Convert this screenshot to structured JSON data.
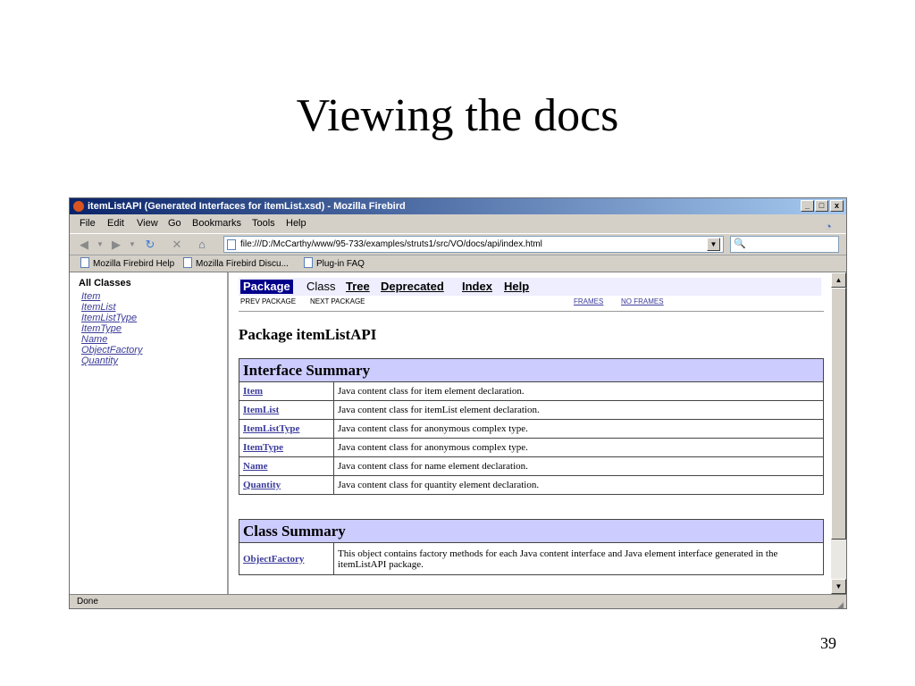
{
  "slide": {
    "title": "Viewing the docs",
    "page_number": "39"
  },
  "window": {
    "title": "itemListAPI (Generated Interfaces for itemList.xsd) - Mozilla Firebird",
    "controls": {
      "minimize": "_",
      "maximize": "□",
      "close": "x"
    }
  },
  "menu": [
    "File",
    "Edit",
    "View",
    "Go",
    "Bookmarks",
    "Tools",
    "Help"
  ],
  "toolbar": {
    "url": "file:///D:/McCarthy/www/95-733/examples/struts1/src/VO/docs/api/index.html",
    "icons": [
      "back-icon",
      "forward-icon",
      "reload-icon",
      "stop-icon",
      "home-icon"
    ]
  },
  "bookmarks": [
    "Mozilla Firebird Help",
    "Mozilla Firebird Discu...",
    "Plug-in FAQ"
  ],
  "left_frame": {
    "heading": "All Classes",
    "classes": [
      "Item",
      "ItemList",
      "ItemListType",
      "ItemType",
      "Name",
      "ObjectFactory",
      "Quantity"
    ]
  },
  "doc": {
    "nav": {
      "current": "Package",
      "plain": "Class",
      "links": [
        "Tree",
        "Deprecated",
        "Index",
        "Help"
      ]
    },
    "subnav": {
      "prev": "PREV PACKAGE",
      "next": "NEXT PACKAGE",
      "frames": "FRAMES",
      "no_frames": "NO FRAMES"
    },
    "package_title": "Package itemListAPI",
    "interface_summary": {
      "heading": "Interface Summary",
      "rows": [
        {
          "name": "Item",
          "desc": "Java content class for item element declaration."
        },
        {
          "name": "ItemList",
          "desc": "Java content class for itemList element declaration."
        },
        {
          "name": "ItemListType",
          "desc": "Java content class for anonymous complex type."
        },
        {
          "name": "ItemType",
          "desc": "Java content class for anonymous complex type."
        },
        {
          "name": "Name",
          "desc": "Java content class for name element declaration."
        },
        {
          "name": "Quantity",
          "desc": "Java content class for quantity element declaration."
        }
      ]
    },
    "class_summary": {
      "heading": "Class Summary",
      "rows": [
        {
          "name": "ObjectFactory",
          "desc": "This object contains factory methods for each Java content interface and Java element interface generated in the itemListAPI package."
        }
      ]
    }
  },
  "status": "Done"
}
